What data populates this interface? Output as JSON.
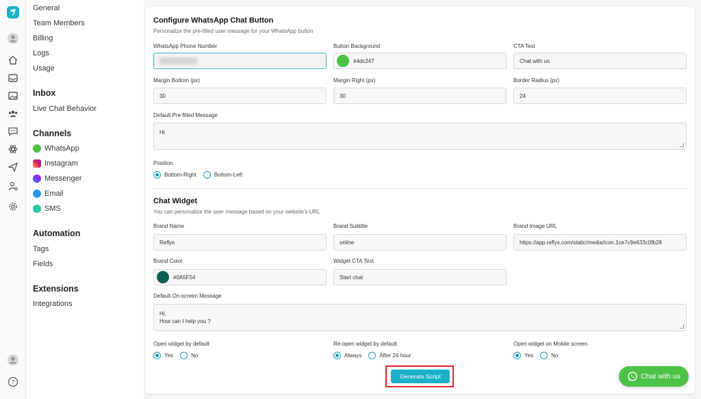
{
  "nav": {
    "general": "General",
    "team_members": "Team Members",
    "billing": "Billing",
    "logs": "Logs",
    "usage": "Usage",
    "inbox_head": "Inbox",
    "live_chat_behavior": "Live Chat Behavior",
    "channels_head": "Channels",
    "channels": [
      "WhatsApp",
      "Instagram",
      "Messenger",
      "Email",
      "SMS"
    ],
    "automation_head": "Automation",
    "tags": "Tags",
    "fields": "Fields",
    "extensions_head": "Extensions",
    "integrations": "Integrations"
  },
  "config": {
    "title": "Configure WhatsApp Chat Button",
    "subtitle": "Personalize the pre-filled user message for your WhatsApp button",
    "phone_label": "WhatsApp Phone Number",
    "phone_value": "",
    "bg_label": "Button Background",
    "bg_value": "#4dc247",
    "cta_label": "CTA Text",
    "cta_value": "Chat with us",
    "mb_label": "Margin Bottom (px)",
    "mb_value": "30",
    "mr_label": "Margin Right (px)",
    "mr_value": "30",
    "br_label": "Border Radius (px)",
    "br_value": "24",
    "msg_label": "Default Pre-filled Message",
    "msg_value": "Hi",
    "position_label": "Position",
    "position_right": "Bottom-Right",
    "position_left": "Bottom-Left"
  },
  "widget": {
    "title": "Chat Widget",
    "subtitle": "You can personalize the user message based on your website's URL",
    "brand_name_label": "Brand Name",
    "brand_name_value": "Reflys",
    "brand_sub_label": "Brand Subtitle",
    "brand_sub_value": "online",
    "brand_img_label": "Brand Image URL",
    "brand_img_value": "https://app.reflys.com/static/media/icon.1ce7c9e633c0fb28",
    "brand_color_label": "Brand Color",
    "brand_color_value": "#0A5F54",
    "cta_label": "Widget CTA Text",
    "cta_value": "Start chat",
    "onscreen_label": "Default On-screen Message",
    "onscreen_line1": "Hi,",
    "onscreen_line2": "How can I help you ?",
    "open_default_label": "Open widget by default",
    "reopen_label": "Re-open widget by default",
    "mobile_label": "Open widget on Mobile screen",
    "yes": "Yes",
    "no": "No",
    "always": "Always",
    "after24": "After 24 hour"
  },
  "generate_button": "Generate Script",
  "chat_fab": "Chat with us",
  "colors": {
    "accent": "#1ab0c8",
    "whatsapp": "#4dc247",
    "brand": "#0A5F54",
    "highlight": "#d9252b"
  }
}
